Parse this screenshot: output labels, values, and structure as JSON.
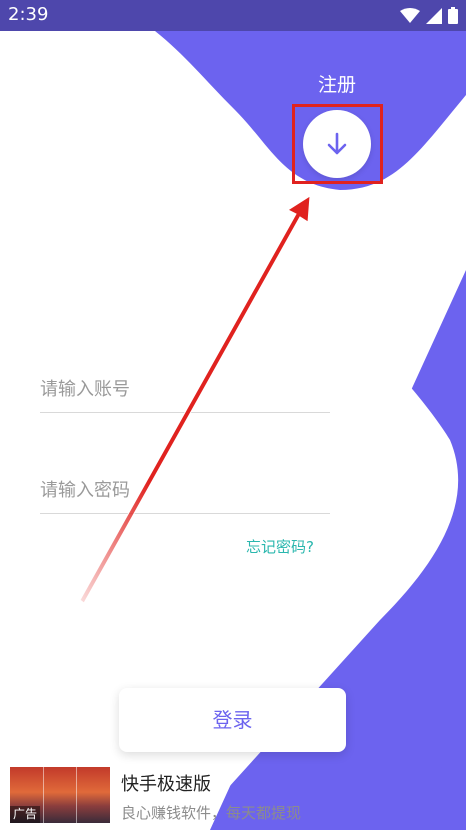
{
  "status": {
    "time": "2:39"
  },
  "header": {
    "register_label": "注册"
  },
  "form": {
    "account_placeholder": "请输入账号",
    "password_placeholder": "请输入密码",
    "forgot_label": "忘记密码?",
    "login_label": "登录"
  },
  "ad": {
    "tag": "广告",
    "title": "快手极速版",
    "subtitle": "良心赚钱软件，每天都提现"
  },
  "colors": {
    "accent": "#6c63ef",
    "link": "#2ab7ae",
    "annotation": "#e0221f"
  },
  "icons": [
    "back-icon",
    "arrow-down-icon",
    "wifi-icon",
    "signal-icon",
    "battery-icon",
    "close-icon"
  ]
}
